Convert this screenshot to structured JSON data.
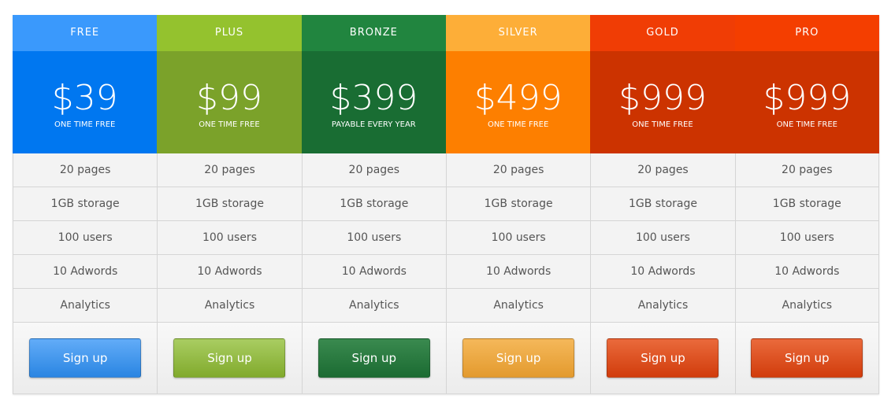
{
  "plans": [
    {
      "name": "FREE",
      "price": "$39",
      "term": "ONE TIME FREE",
      "features": [
        "20 pages",
        "1GB storage",
        "100 users",
        "10 Adwords",
        "Analytics"
      ],
      "button": "Sign up",
      "colors": {
        "head": "#3a99fc",
        "price": "#0077f0",
        "btn_top": "#62acf8",
        "btn_bottom": "#2a85e2"
      }
    },
    {
      "name": "PLUS",
      "price": "$99",
      "term": "ONE TIME FREE",
      "features": [
        "20 pages",
        "1GB storage",
        "100 users",
        "10 Adwords",
        "Analytics"
      ],
      "button": "Sign up",
      "colors": {
        "head": "#94c22e",
        "price": "#7ba22a",
        "btn_top": "#a9cd62",
        "btn_bottom": "#81aa2c"
      }
    },
    {
      "name": "BRONZE",
      "price": "$399",
      "term": "PAYABLE EVERY YEAR",
      "features": [
        "20 pages",
        "1GB storage",
        "100 users",
        "10 Adwords",
        "Analytics"
      ],
      "button": "Sign up",
      "colors": {
        "head": "#21853f",
        "price": "#196d33",
        "btn_top": "#3a8a4f",
        "btn_bottom": "#1b6b32"
      }
    },
    {
      "name": "SILVER",
      "price": "$499",
      "term": "ONE TIME FREE",
      "features": [
        "20 pages",
        "1GB storage",
        "100 users",
        "10 Adwords",
        "Analytics"
      ],
      "button": "Sign up",
      "colors": {
        "head": "#fdae38",
        "price": "#fd7f00",
        "btn_top": "#f5b85a",
        "btn_bottom": "#e39a2e"
      }
    },
    {
      "name": "GOLD",
      "price": "$999",
      "term": "ONE TIME FREE",
      "features": [
        "20 pages",
        "1GB storage",
        "100 users",
        "10 Adwords",
        "Analytics"
      ],
      "button": "Sign up",
      "colors": {
        "head": "#f03d05",
        "price": "#cc3300",
        "btn_top": "#ea6a3c",
        "btn_bottom": "#d13c0c"
      }
    },
    {
      "name": "PRO",
      "price": "$999",
      "term": "ONE TIME FREE",
      "features": [
        "20 pages",
        "1GB storage",
        "100 users",
        "10 Adwords",
        "Analytics"
      ],
      "button": "Sign up",
      "colors": {
        "head": "#f43e00",
        "price": "#cc3300",
        "btn_top": "#ea6a3c",
        "btn_bottom": "#d13c0c"
      }
    }
  ]
}
